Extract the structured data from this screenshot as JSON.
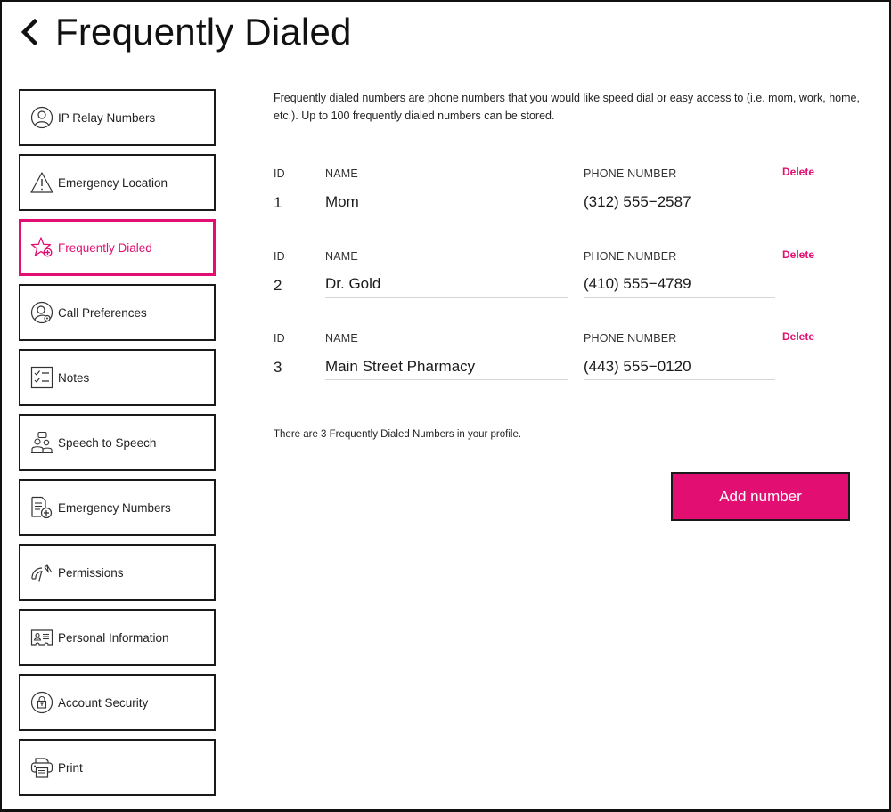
{
  "header": {
    "back_icon": "chevron-left-icon",
    "title": "Frequently Dialed"
  },
  "sidebar": {
    "active_index": 2,
    "items": [
      {
        "label": "IP Relay Numbers",
        "icon": "user-circle-icon"
      },
      {
        "label": "Emergency Location",
        "icon": "warning-triangle-icon"
      },
      {
        "label": "Frequently Dialed",
        "icon": "star-plus-icon"
      },
      {
        "label": "Call Preferences",
        "icon": "user-gear-icon"
      },
      {
        "label": "Notes",
        "icon": "checklist-icon"
      },
      {
        "label": "Speech to Speech",
        "icon": "people-chat-icon"
      },
      {
        "label": "Emergency Numbers",
        "icon": "document-plus-icon"
      },
      {
        "label": "Permissions",
        "icon": "gauge-icon"
      },
      {
        "label": "Personal Information",
        "icon": "id-card-icon"
      },
      {
        "label": "Account Security",
        "icon": "lock-circle-icon"
      },
      {
        "label": "Print",
        "icon": "printer-icon"
      }
    ]
  },
  "main": {
    "intro": "Frequently dialed numbers are phone numbers that you would like speed dial or easy access to (i.e. mom, work, home, etc.). Up to 100 frequently dialed numbers can be stored.",
    "columns": {
      "id": "ID",
      "name": "NAME",
      "phone": "PHONE NUMBER"
    },
    "delete_label": "Delete",
    "entries": [
      {
        "id": "1",
        "name": "Mom",
        "phone": "(312) 555−2587"
      },
      {
        "id": "2",
        "name": "Dr. Gold",
        "phone": "(410) 555−4789"
      },
      {
        "id": "3",
        "name": "Main Street Pharmacy",
        "phone": "(443) 555−0120"
      }
    ],
    "count_text": "There are 3 Frequently Dialed Numbers in your profile.",
    "add_button": "Add number"
  },
  "colors": {
    "accent": "#e20e72",
    "text": "#1a1a1a",
    "border": "#1a1a1a",
    "field_underline": "#d6d6d6"
  }
}
